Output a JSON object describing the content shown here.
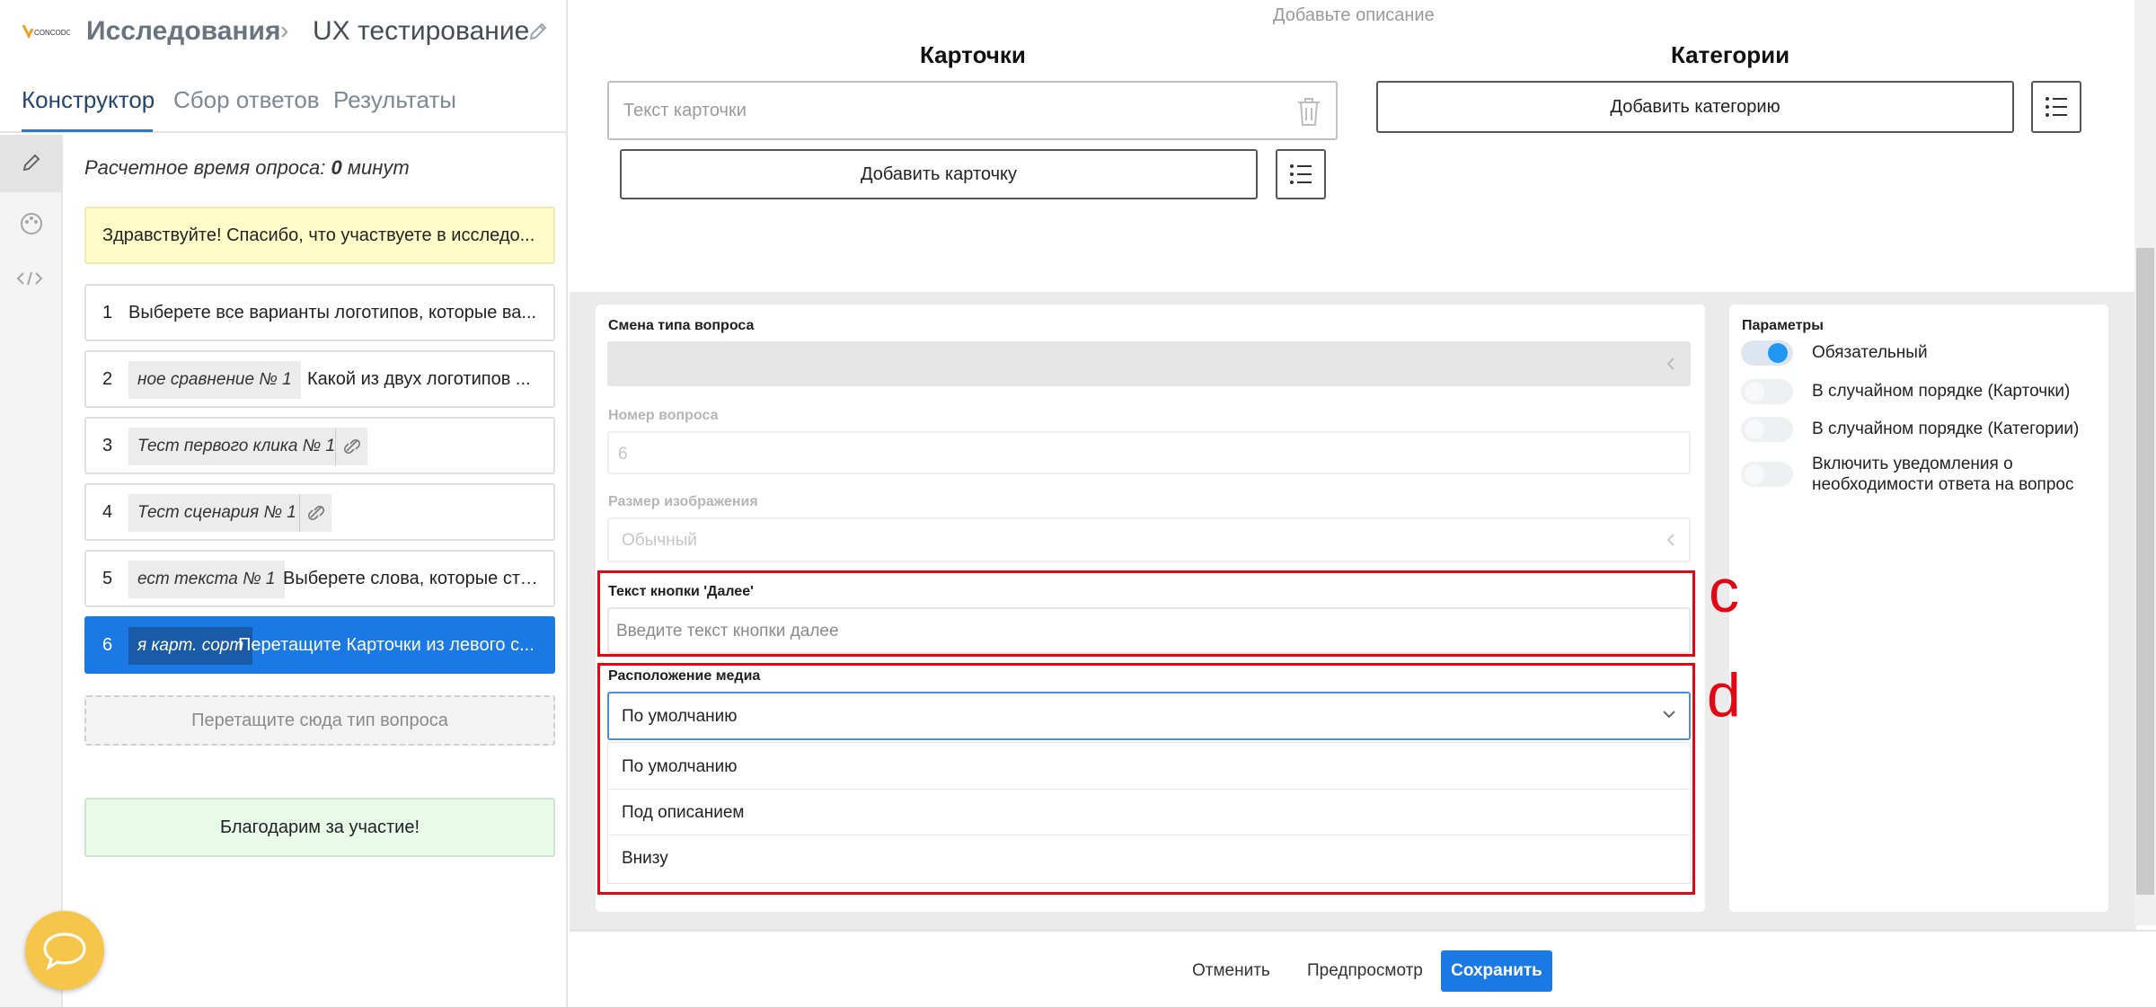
{
  "header": {
    "logo_text": "CONCODO",
    "title": "Исследования",
    "separator": "›",
    "subtitle": "UX тестирование"
  },
  "tabs": [
    {
      "label": "Конструктор",
      "active": true
    },
    {
      "label": "Сбор ответов",
      "active": false
    },
    {
      "label": "Результаты",
      "active": false
    }
  ],
  "tools": [
    "pencil-icon",
    "palette-icon",
    "code-icon"
  ],
  "survey": {
    "estimate_prefix": "Расчетное время опроса:",
    "estimate_value": "0",
    "estimate_unit": "минут",
    "welcome": "Здравствуйте! Спасибо, что участвуете в исследо...",
    "questions": [
      {
        "num": "1",
        "tag": "",
        "text": "Выберете все варианты логотипов, которые ва..."
      },
      {
        "num": "2",
        "tag": "ное сравнение № 1",
        "text": "Какой из двух логотипов ..."
      },
      {
        "num": "3",
        "tag": "Тест первого клика № 1",
        "text": ""
      },
      {
        "num": "4",
        "tag": "Тест сценария № 1",
        "text": ""
      },
      {
        "num": "5",
        "tag": "ест текста № 1",
        "text": "Выберете слова, которые сто..."
      },
      {
        "num": "6",
        "tag": "я карт. сорт",
        "text": "Перетащите Карточки из левого с..."
      }
    ],
    "drop_hint": "Перетащите сюда тип вопроса",
    "thanks": "Благодарим за участие!"
  },
  "editor": {
    "description_hint": "Добавьте описание",
    "cards_header": "Карточки",
    "categories_header": "Категории",
    "card_placeholder": "Текст карточки",
    "add_card": "Добавить карточку",
    "add_category": "Добавить категорию"
  },
  "form": {
    "type_label": "Смена типа вопроса",
    "number_label": "Номер вопроса",
    "number_value": "6",
    "image_size_label": "Размер изображения",
    "image_size_value": "Обычный",
    "next_button_label": "Текст кнопки 'Далее'",
    "next_button_placeholder": "Введите текст кнопки далее",
    "media_label": "Расположение медиа",
    "media_selected": "По умолчанию",
    "media_options": [
      "По умолчанию",
      "Под описанием",
      "Внизу"
    ]
  },
  "params": {
    "title": "Параметры",
    "items": [
      {
        "label": "Обязательный",
        "on": true
      },
      {
        "label": "В случайном порядке (Карточки)",
        "on": false
      },
      {
        "label": "В случайном порядке (Категории)",
        "on": false
      },
      {
        "label": "Включить уведомления о необходимости ответа на вопрос",
        "on": false
      }
    ]
  },
  "annotations": {
    "c": "c",
    "d": "d",
    "color": "#e30613"
  },
  "footer": {
    "cancel": "Отменить",
    "preview": "Предпросмотр",
    "save": "Сохранить"
  },
  "colors": {
    "accent": "#1b79e6",
    "toggle_on": "#2196f3",
    "welcome_bg": "#fefdc9",
    "thanks_bg": "#e7fbe8"
  }
}
